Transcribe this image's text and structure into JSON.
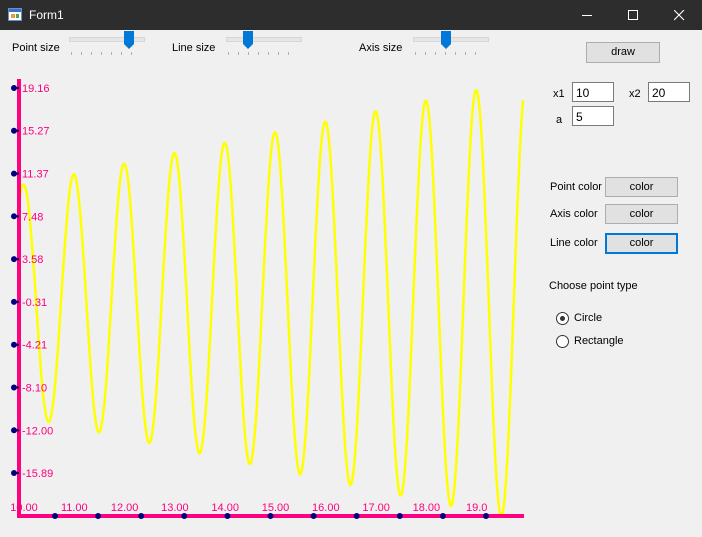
{
  "window": {
    "title": "Form1"
  },
  "toolbar": {
    "point_size_label": "Point size",
    "line_size_label": "Line size",
    "axis_size_label": "Axis size",
    "draw_label": "draw"
  },
  "sliders": {
    "point_size": 0.86,
    "line_size": 0.26,
    "axis_size": 0.44
  },
  "params": {
    "x1_label": "x1",
    "x1_value": "10",
    "x2_label": "x2",
    "x2_value": "20",
    "a_label": "a",
    "a_value": "5"
  },
  "colors_panel": {
    "point_color_label": "Point color",
    "axis_color_label": "Axis color",
    "line_color_label": "Line color",
    "color_button": "color",
    "point_color": "#000080",
    "axis_color": "#ff0080",
    "line_color": "#ffff00"
  },
  "point_type": {
    "heading": "Choose point type",
    "options": [
      "Circle",
      "Rectangle"
    ],
    "selected": "Circle"
  },
  "chart_data": {
    "type": "line",
    "y_tick_labels": [
      "19.16",
      "15.27",
      "11.37",
      "7.48",
      "3.58",
      "-0.31",
      "-4.21",
      "-8.10",
      "-12.00",
      "-15.89"
    ],
    "x_tick_labels": [
      "10.00",
      "11.00",
      "12.00",
      "13.00",
      "14.00",
      "15.00",
      "16.00",
      "17.00",
      "18.00",
      "19.0"
    ],
    "xlim": [
      10,
      20
    ],
    "ylim": [
      -19.8,
      19.16
    ],
    "line_color": "#ffff00",
    "axis_color": "#ff0080",
    "point_color": "#000080"
  }
}
